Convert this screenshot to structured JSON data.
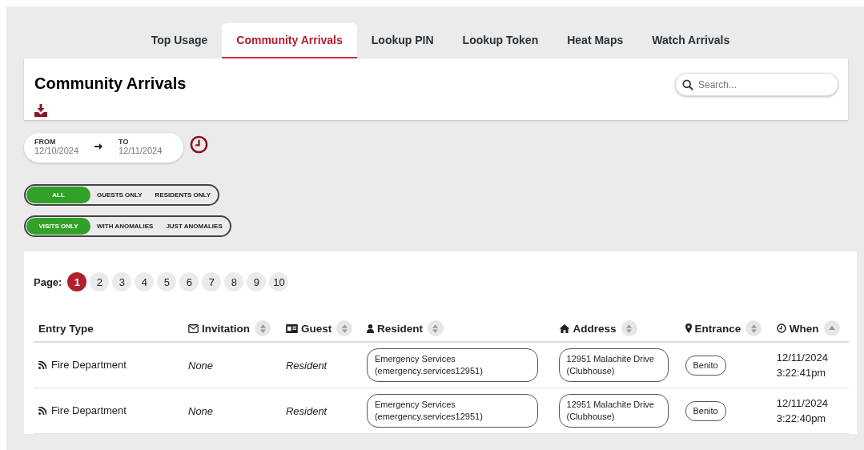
{
  "tabs": [
    {
      "label": "Top Usage",
      "selected": false
    },
    {
      "label": "Community Arrivals",
      "selected": true
    },
    {
      "label": "Lookup PIN",
      "selected": false
    },
    {
      "label": "Lookup Token",
      "selected": false
    },
    {
      "label": "Heat Maps",
      "selected": false
    },
    {
      "label": "Watch Arrivals",
      "selected": false
    }
  ],
  "header": {
    "title": "Community Arrivals",
    "search": {
      "placeholder": "Search..."
    }
  },
  "date_range": {
    "from_label": "FROM",
    "from": "12/10/2024",
    "to_label": "TO",
    "to": "12/11/2024"
  },
  "filters": [
    [
      {
        "label": "ALL",
        "selected": true
      },
      {
        "label": "GUESTS ONLY",
        "selected": false
      },
      {
        "label": "RESIDENTS ONLY",
        "selected": false
      }
    ],
    [
      {
        "label": "VISITS ONLY",
        "selected": true
      },
      {
        "label": "WITH ANOMALIES",
        "selected": false
      },
      {
        "label": "JUST ANOMALIES",
        "selected": false
      }
    ]
  ],
  "pagination": {
    "label": "Page:",
    "pages": [
      {
        "label": "1",
        "selected": true
      },
      {
        "label": "2",
        "selected": false
      },
      {
        "label": "3",
        "selected": false
      },
      {
        "label": "4",
        "selected": false
      },
      {
        "label": "5",
        "selected": false
      },
      {
        "label": "6",
        "selected": false
      },
      {
        "label": "7",
        "selected": false
      },
      {
        "label": "8",
        "selected": false
      },
      {
        "label": "9",
        "selected": false
      },
      {
        "label": "10",
        "selected": false
      }
    ]
  },
  "table": {
    "columns": [
      {
        "label": "Entry Type"
      },
      {
        "label": "Invitation",
        "sorted": false
      },
      {
        "label": "Guest",
        "sorted": false
      },
      {
        "label": "Resident",
        "sorted": false
      },
      {
        "label": "Address",
        "sorted": false
      },
      {
        "label": "Entrance",
        "sorted": false
      },
      {
        "label": "When",
        "sorted": true
      }
    ],
    "rows": [
      {
        "entry_type": "Fire Department",
        "invitation": "None",
        "guest": "Resident",
        "resident": [
          "Emergency Services",
          "(emergency.services12951)"
        ],
        "address": [
          "12951 Malachite Drive",
          "(Clubhouse)"
        ],
        "entrance": "Benito",
        "when": [
          "12/11/2024",
          "3:22:41pm"
        ]
      },
      {
        "entry_type": "Fire Department",
        "invitation": "None",
        "guest": "Resident",
        "resident": [
          "Emergency Services",
          "(emergency.services12951)"
        ],
        "address": [
          "12951 Malachite Drive",
          "(Clubhouse)"
        ],
        "entrance": "Benito",
        "when": [
          "12/11/2024",
          "3:22:40pm"
        ]
      }
    ]
  }
}
